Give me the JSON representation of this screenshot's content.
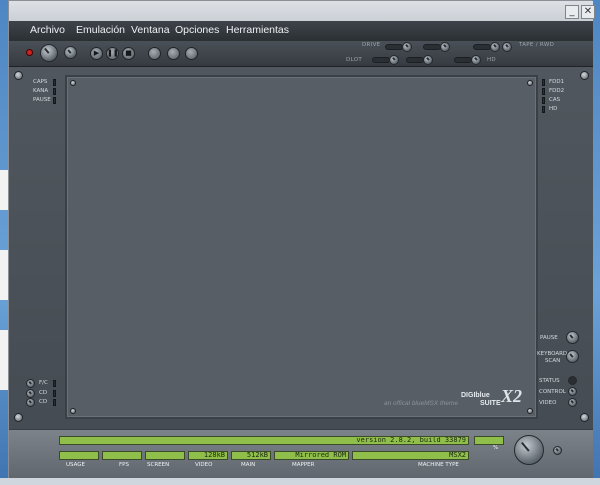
{
  "window": {
    "minimize_label": "_",
    "close_label": "✕"
  },
  "menu": {
    "items": [
      "Archivo",
      "Emulación",
      "Ventana",
      "Opciones",
      "Herramientas"
    ]
  },
  "toolbar": {
    "play_glyph": "▶",
    "pause_glyph": "❚❚",
    "stop_glyph": "■",
    "drive_label": "DRIVE",
    "dlot_label": "DLOT",
    "tape_label": "TAPE / RWD",
    "hd_label": "HD"
  },
  "left_leds": [
    "CAPS",
    "KANA",
    "PAUSE"
  ],
  "left_leds_bottom": [
    "F/C",
    "CD",
    "CD"
  ],
  "right_leds": [
    "FDD1",
    "FDD2",
    "CAS",
    "HD"
  ],
  "right_controls": {
    "controls": [
      "PAUSE",
      "KEYBOARD"
    ],
    "keyboard_sub": "SCAN",
    "rows": [
      "STATUS",
      "CONTROL",
      "VIDEO"
    ]
  },
  "branding": {
    "digiblue": "DIGIblue",
    "suite": "SUITE",
    "x2": "X2",
    "tagline": "an offical blueMSX theme"
  },
  "status": {
    "version": "version 2.8.2, build 33879",
    "fields": [
      {
        "label": "USAGE",
        "value": ""
      },
      {
        "label": "FPS",
        "value": ""
      },
      {
        "label": "SCREEN",
        "value": ""
      },
      {
        "label": "VIDEO",
        "value": "128kB"
      },
      {
        "label": "MAIN",
        "value": "512kB"
      },
      {
        "label": "MAPPER",
        "value": "Mirrored ROM"
      },
      {
        "label": "MACHINE TYPE",
        "value": "MSX2"
      }
    ],
    "volume_symbol": "%"
  }
}
